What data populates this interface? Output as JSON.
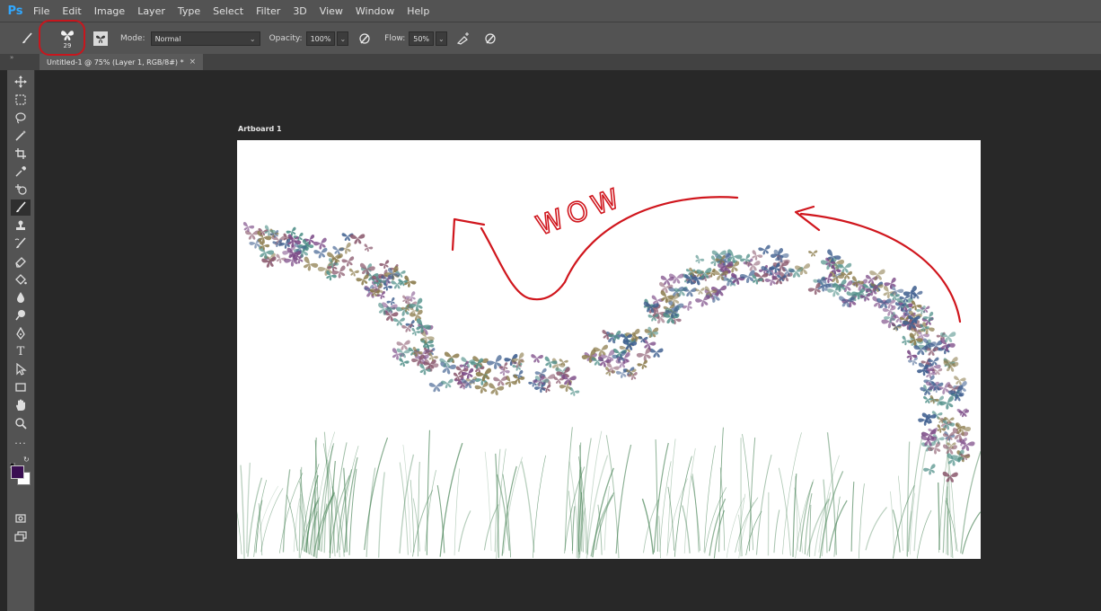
{
  "app": {
    "logo": "Ps"
  },
  "menu": [
    "File",
    "Edit",
    "Image",
    "Layer",
    "Type",
    "Select",
    "Filter",
    "3D",
    "View",
    "Window",
    "Help"
  ],
  "options_bar": {
    "brush_tool_icon": "brush-icon",
    "brush_preset_icon": "butterfly-icon",
    "brush_size": "29",
    "toggle_panel_icon": "brush-panel-icon",
    "mode_label": "Mode:",
    "mode_value": "Normal",
    "opacity_label": "Opacity:",
    "opacity_value": "100%",
    "flow_label": "Flow:",
    "flow_value": "50%"
  },
  "document_tab": {
    "title": "Untitled-1 @ 75% (Layer 1, RGB/8#) *",
    "close": "×"
  },
  "toolbox": {
    "tools": [
      "move-tool",
      "marquee-tool",
      "lasso-tool",
      "magic-wand-tool",
      "crop-tool",
      "eyedropper-tool",
      "healing-brush-tool",
      "brush-tool",
      "clone-stamp-tool",
      "history-brush-tool",
      "eraser-tool",
      "paint-bucket-tool",
      "blur-tool",
      "dodge-tool",
      "pen-tool",
      "type-tool",
      "path-selection-tool",
      "rectangle-tool",
      "hand-tool",
      "zoom-tool",
      "more-tools"
    ],
    "active_tool": "brush-tool",
    "foreground_color": "#3a0f52",
    "background_color": "#ffffff"
  },
  "canvas": {
    "artboard_label": "Artboard 1",
    "annotation_text": "WOW",
    "annotation_color": "#d0161d",
    "butterfly_colors": [
      "#7b4a86",
      "#4f8f88",
      "#8a7a4a",
      "#3f5f8f",
      "#8b5a6e"
    ],
    "grass_color": "#3f7d4e"
  }
}
